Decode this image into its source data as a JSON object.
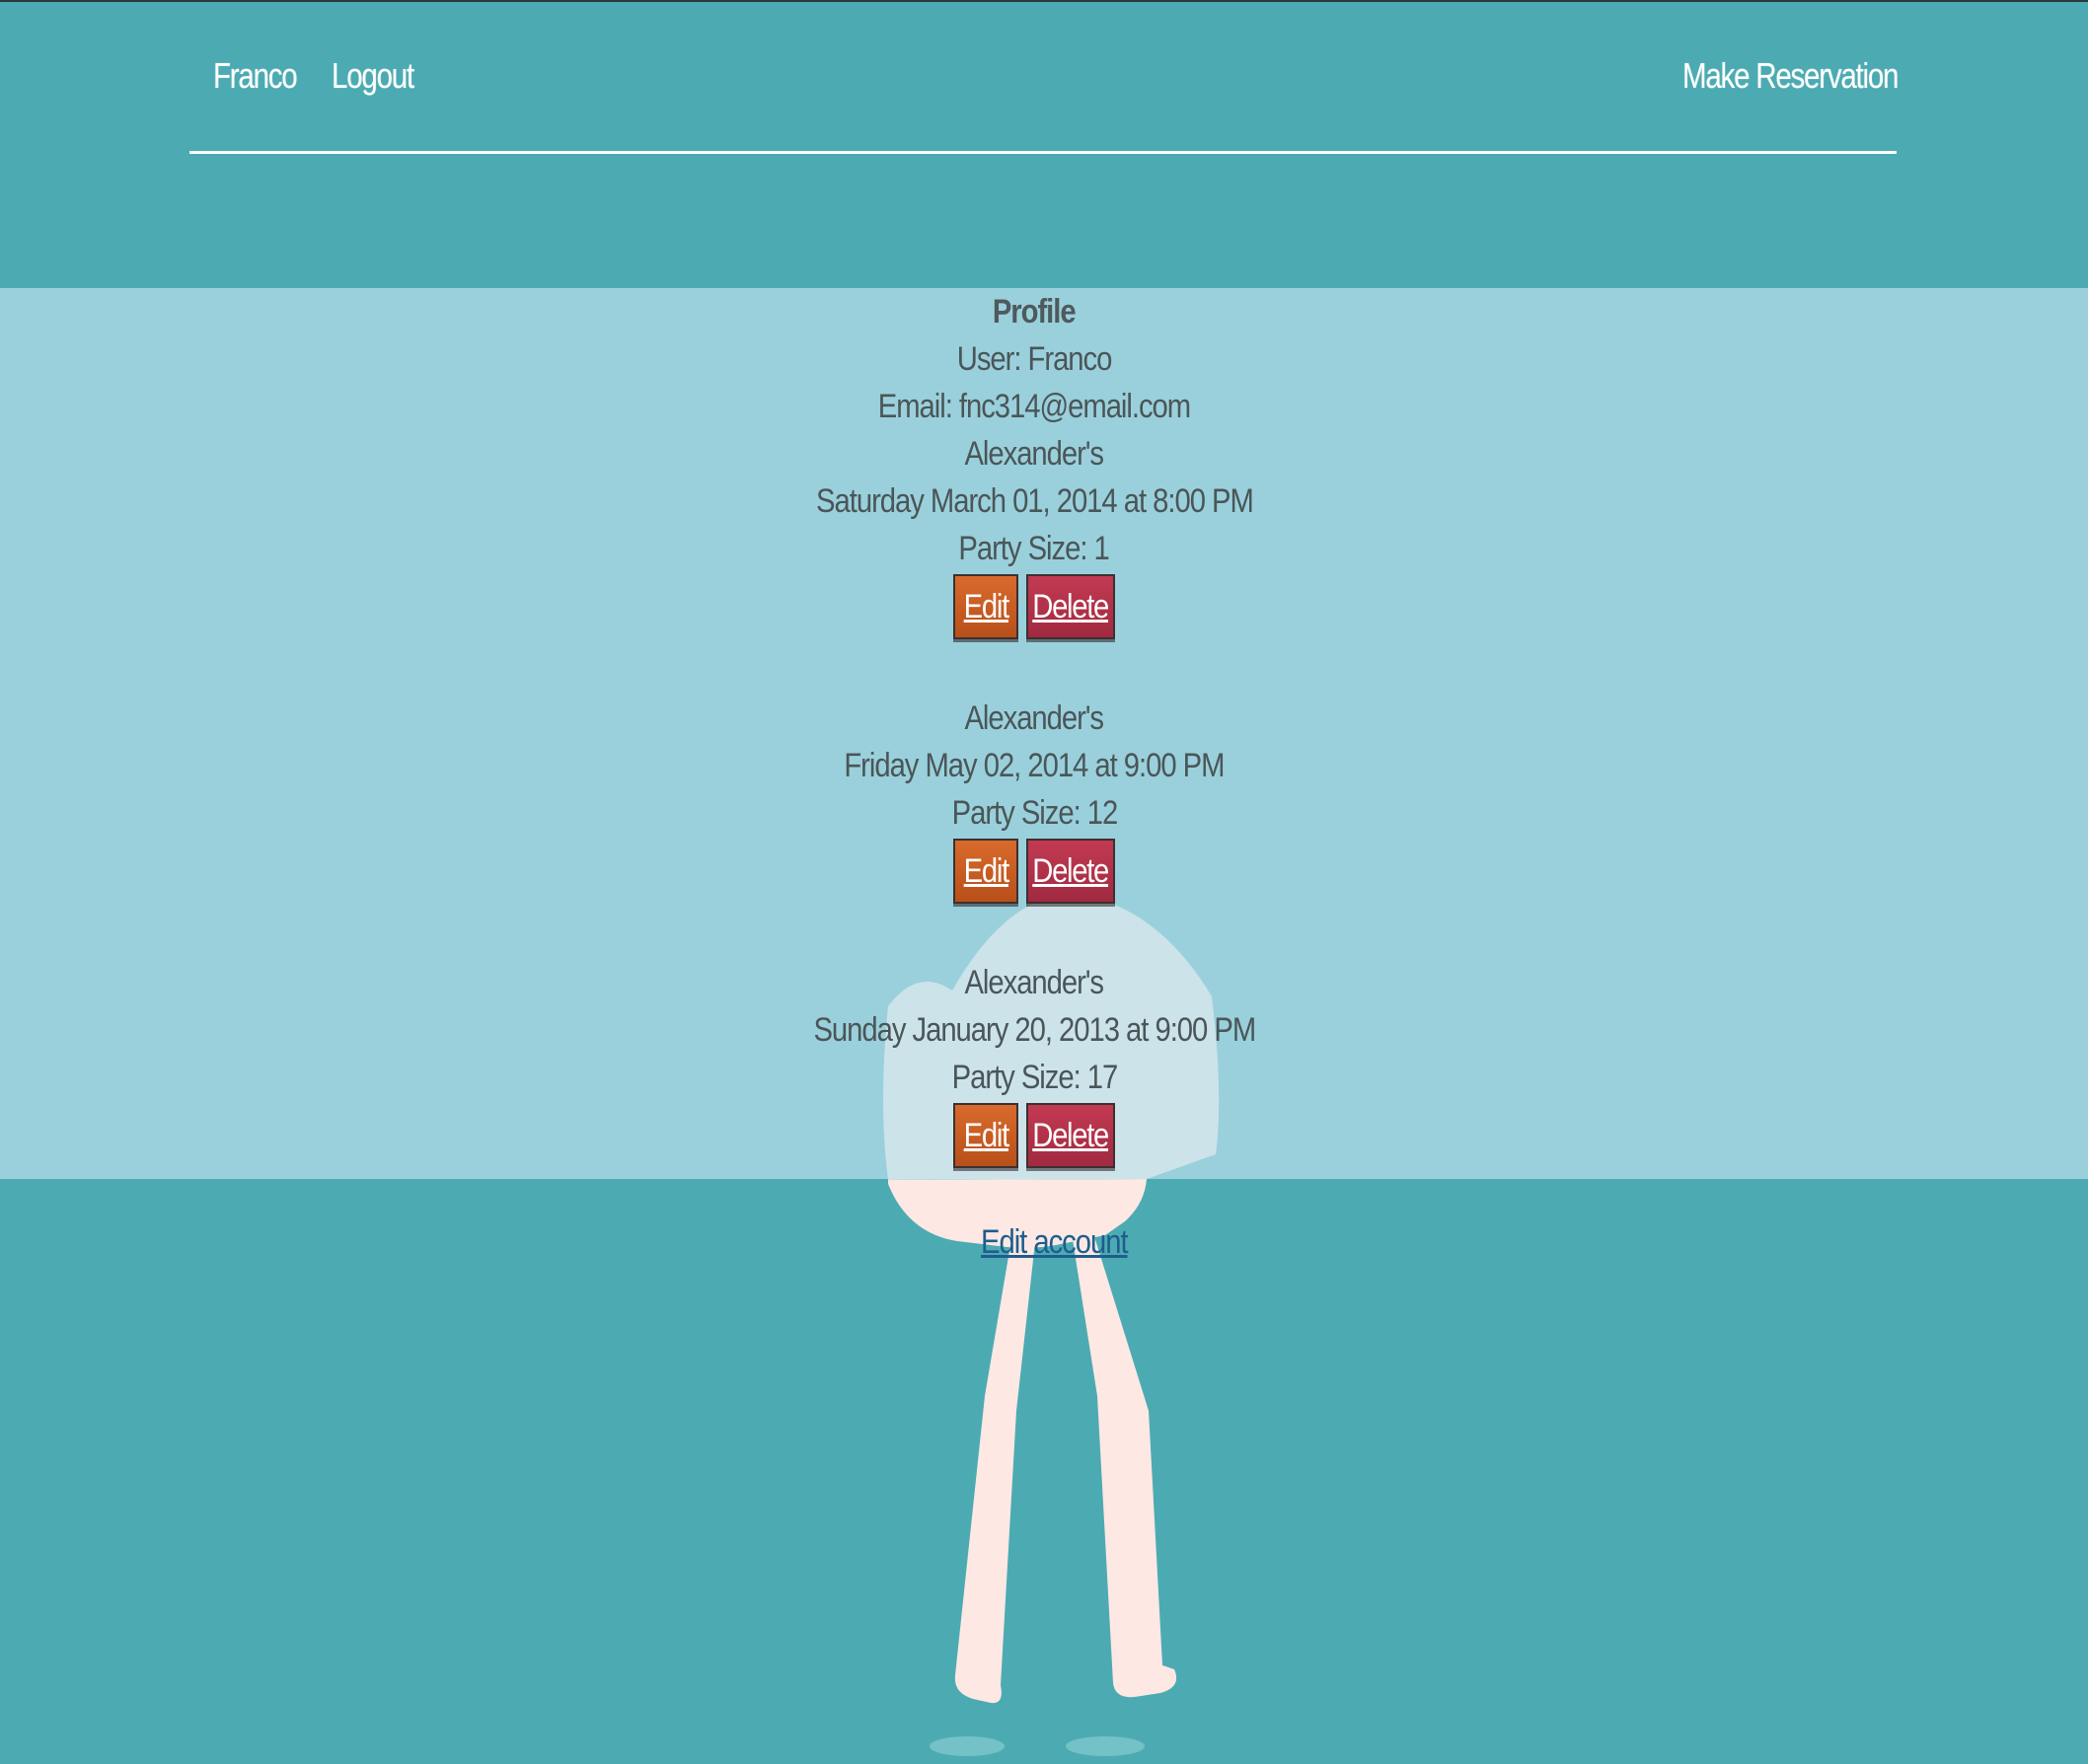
{
  "nav": {
    "user_label": "Franco",
    "logout_label": "Logout",
    "reserve_label": "Make Reservation"
  },
  "profile": {
    "title": "Profile",
    "user_line": "User: Franco",
    "email_line": "Email: fnc314@email.com"
  },
  "reservations": [
    {
      "restaurant": "Alexander's",
      "datetime": "Saturday March 01, 2014 at 8:00 PM",
      "party": "Party Size: 1",
      "edit_label": "Edit",
      "delete_label": "Delete"
    },
    {
      "restaurant": "Alexander's",
      "datetime": "Friday May 02, 2014 at 9:00 PM",
      "party": "Party Size: 12",
      "edit_label": "Edit",
      "delete_label": "Delete"
    },
    {
      "restaurant": "Alexander's",
      "datetime": "Sunday January 20, 2013 at 9:00 PM",
      "party": "Party Size: 17",
      "edit_label": "Edit",
      "delete_label": "Delete"
    }
  ],
  "footer": {
    "edit_account_label": "Edit account"
  },
  "colors": {
    "page_background": "#4cabb2",
    "content_band": "#9ad0dc",
    "edit_button": "#c55d22",
    "delete_button": "#b0324a",
    "link": "#1f5d8c",
    "mascot": "#fde8e4"
  }
}
